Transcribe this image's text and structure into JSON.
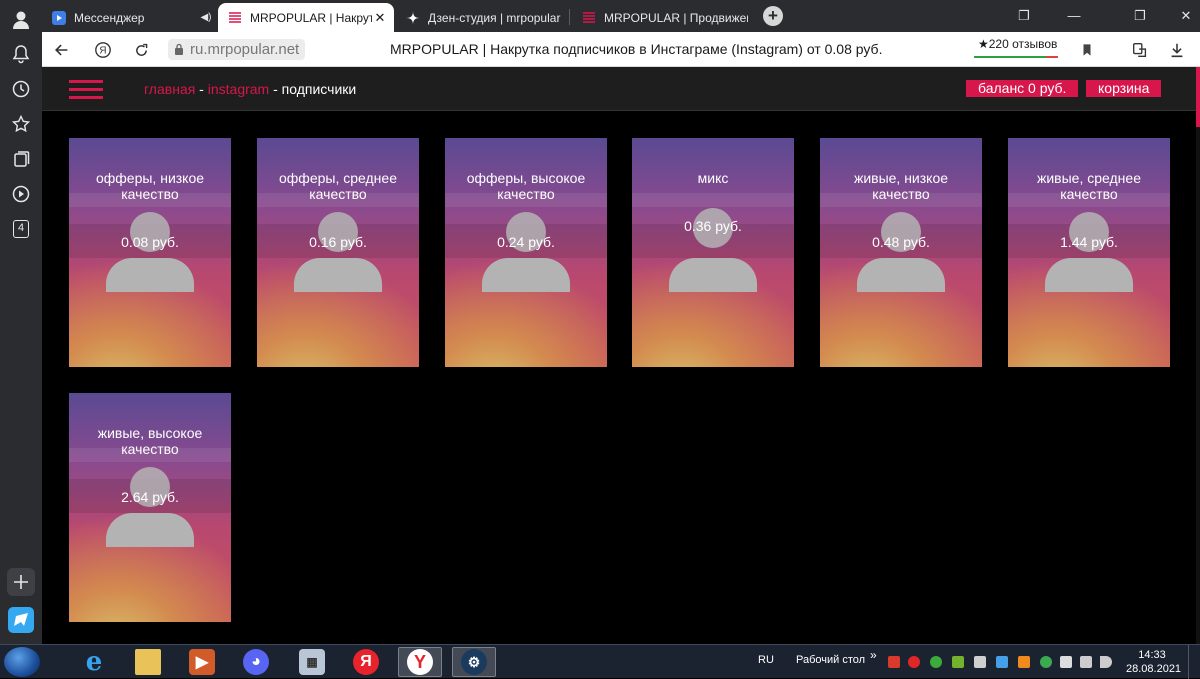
{
  "browser": {
    "tabs": [
      {
        "title": "Мессенджер",
        "icon": "messenger-icon",
        "audio": true
      },
      {
        "title": "MRPOPULAR | Накрутка",
        "icon": "mrpopular-icon",
        "active": true
      },
      {
        "title": "Дзен-студия | mrpopular |",
        "icon": "dzen-icon"
      },
      {
        "title": "MRPOPULAR | Продвижен",
        "icon": "mrpopular-icon"
      }
    ],
    "new_tab_label": "+",
    "address": "ru.mrpopular.net",
    "page_title": "MRPOPULAR | Накрутка подписчиков в Инстаграме (Instagram) от 0.08 руб.",
    "reviews": "★220 отзывов",
    "sidebar_badge": "4"
  },
  "site": {
    "breadcrumb": {
      "home": "главная",
      "sep1": " - ",
      "instagram": "instagram",
      "sep2": " - ",
      "current": "подписчики"
    },
    "balance_label": "баланс 0 руб.",
    "cart_label": "корзина",
    "accent_color": "#d7164b"
  },
  "cards": [
    {
      "title": "офферы, низкое качество",
      "price": "0.08 руб."
    },
    {
      "title": "офферы, среднее качество",
      "price": "0.16 руб."
    },
    {
      "title": "офферы, высокое качество",
      "price": "0.24 руб."
    },
    {
      "title": "микс",
      "price": "0.36 руб."
    },
    {
      "title": "живые, низкое качество",
      "price": "0.48 руб."
    },
    {
      "title": "живые, среднее качество",
      "price": "1.44 руб."
    },
    {
      "title": "живые, высокое качество",
      "price": "2.64 руб."
    }
  ],
  "taskbar": {
    "language": "RU",
    "desktop_label": "Рабочий стол",
    "chevron": "»",
    "time": "14:33",
    "date": "28.08.2021",
    "yandex_glyph": "Я"
  }
}
